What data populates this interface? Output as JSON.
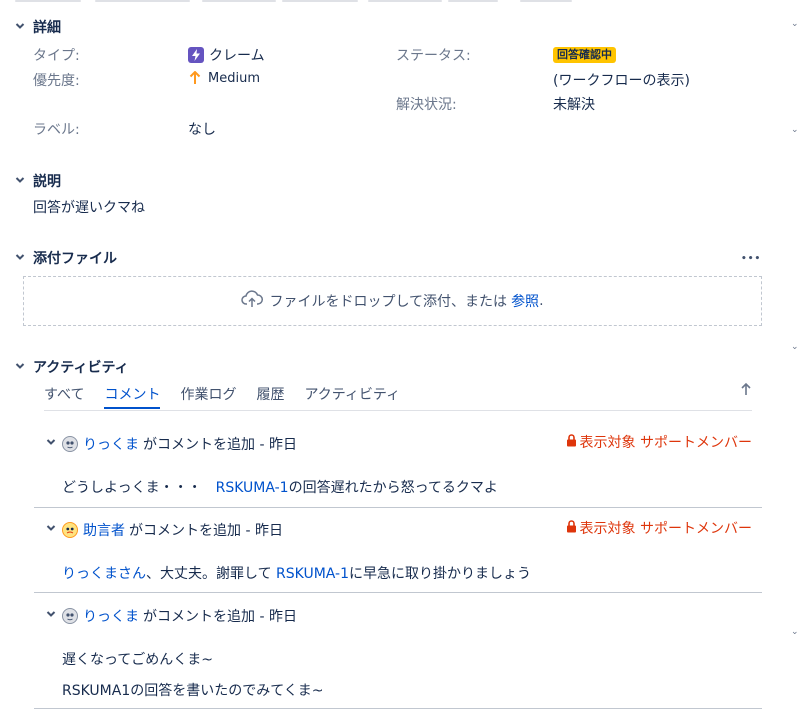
{
  "details": {
    "title": "詳細",
    "type_label": "タイプ:",
    "type_value": "クレーム",
    "priority_label": "優先度:",
    "priority_value": "Medium",
    "status_label": "ステータス:",
    "status_value": "回答確認中",
    "workflow_link": "(ワークフローの表示)",
    "resolution_label": "解決状況:",
    "resolution_value": "未解決",
    "labels_label": "ラベル:",
    "labels_value": "なし"
  },
  "description": {
    "title": "説明",
    "text": "回答が遅いクマね"
  },
  "attachments": {
    "title": "添付ファイル",
    "more": "•••",
    "drop_text": "ファイルをドロップして添付、または",
    "browse_link": "参照",
    "browse_suffix": "."
  },
  "activity": {
    "title": "アクティビティ",
    "tabs": [
      {
        "label": "すべて",
        "active": false
      },
      {
        "label": "コメント",
        "active": true
      },
      {
        "label": "作業ログ",
        "active": false
      },
      {
        "label": "履歴",
        "active": false
      },
      {
        "label": "アクティビティ",
        "active": false
      }
    ],
    "comments": [
      {
        "author": "りっくま",
        "action": "がコメントを追加 - 昨日",
        "visibility": "表示対象 サポートメンバー",
        "lines": [
          {
            "pre": "どうしよっくま・・・　",
            "link": "RSKUMA-1",
            "post": "の回答遅れたから怒ってるクマよ"
          }
        ]
      },
      {
        "author": "助言者",
        "action": "がコメントを追加 - 昨日",
        "visibility": "表示対象 サポートメンバー",
        "lines": [
          {
            "pre_link": "りっくまさん",
            "pre": "、大丈夫。謝罪して ",
            "link": "RSKUMA-1",
            "post": "に早急に取り掛かりましょう"
          }
        ]
      },
      {
        "author": "りっくま",
        "action": "がコメントを追加 - 昨日",
        "visibility": "",
        "lines": [
          {
            "text": "遅くなってごめんくま~"
          },
          {
            "text": "RSKUMA1の回答を書いたのでみてくま~"
          }
        ]
      }
    ]
  },
  "colors": {
    "accent": "#0052cc",
    "status_badge": "#ffc400",
    "restricted": "#de350b",
    "type_icon": "#6554c0",
    "priority": "#ff991f"
  },
  "icons": {
    "collapse": "chevron-down-icon",
    "type": "lightning-icon",
    "priority": "arrow-up-icon",
    "upload": "cloud-upload-icon",
    "lock": "lock-icon",
    "sort": "arrow-up-sort-icon"
  }
}
